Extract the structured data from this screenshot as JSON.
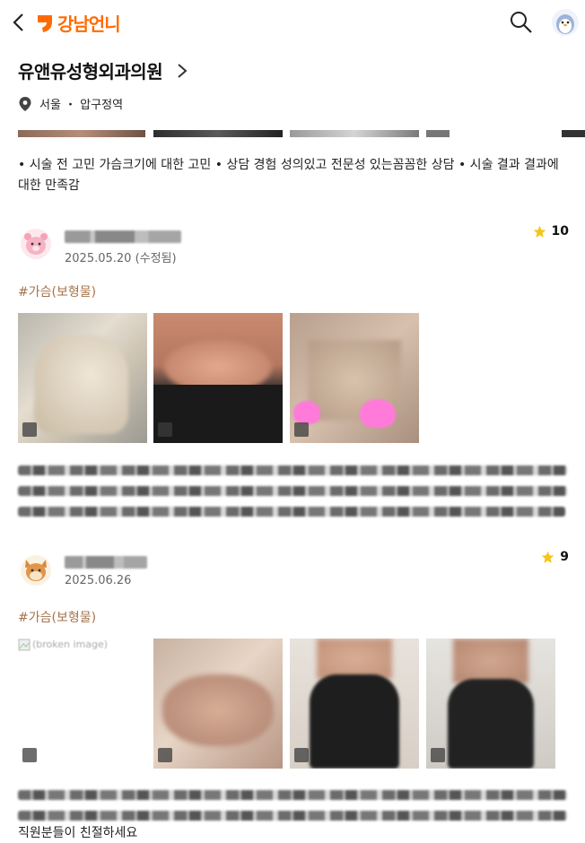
{
  "header": {
    "logo_text": "강남언니",
    "brand_color": "#ff6b00"
  },
  "clinic": {
    "name": "유앤유성형외과의원",
    "location": "서울 ・ 압구정역"
  },
  "intro_text": "• 시술 전 고민 가슴크기에 대한 고민 • 상담 경험 성의있고 전문성 있는꼼꼼한 상담 • 시술 결과 결과에 대한 만족감",
  "reviews": [
    {
      "date": "2025.05.20 (수정됨)",
      "rating": "10",
      "tag": "#가슴(보형물)",
      "photos": [
        "beige-slip",
        "black-bra",
        "bra-with-censor"
      ]
    },
    {
      "date": "2025.06.26",
      "rating": "9",
      "tag": "#가슴(보형물)",
      "photos": [
        "broken-image",
        "nude-bra",
        "black-halter",
        "black-halter-2"
      ],
      "broken_alt": "(broken image)",
      "last_line_tail": "직원분들이 친절하세요"
    }
  ],
  "colors": {
    "tag": "#a6734a",
    "star": "#f5c518"
  }
}
